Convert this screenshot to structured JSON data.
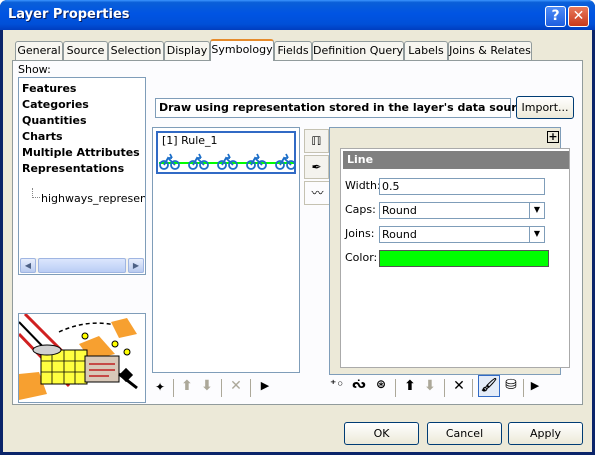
{
  "window": {
    "title": "Layer Properties"
  },
  "titlebar_buttons": {
    "help": "?",
    "close": "✕"
  },
  "tabs": [
    {
      "label": "General"
    },
    {
      "label": "Source"
    },
    {
      "label": "Selection"
    },
    {
      "label": "Display"
    },
    {
      "label": "Symbology"
    },
    {
      "label": "Fields"
    },
    {
      "label": "Definition Query"
    },
    {
      "label": "Labels"
    },
    {
      "label": "Joins & Relates"
    }
  ],
  "symbology": {
    "show_label": "Show:",
    "tree_items": [
      "Features",
      "Categories",
      "Quantities",
      "Charts",
      "Multiple Attributes",
      "Representations"
    ],
    "tree_subitem": "highways_representat",
    "description": "Draw using representation stored in the layer's data source.",
    "import_label": "Import...",
    "rule_label": "[1] Rule_1",
    "properties": {
      "header": "Line",
      "expand": "+",
      "width_label": "Width:",
      "width_value": "0.5",
      "caps_label": "Caps:",
      "caps_value": "Round",
      "joins_label": "Joins:",
      "joins_value": "Round",
      "color_label": "Color:",
      "color_value": "#00ff00"
    }
  },
  "footer": {
    "ok_label": "OK",
    "cancel_label": "Cancel",
    "apply_label": "Apply"
  },
  "colors": {
    "title_bar": "#0054e3",
    "tab_accent": "#e68b2c",
    "selection": "#316ac5"
  }
}
